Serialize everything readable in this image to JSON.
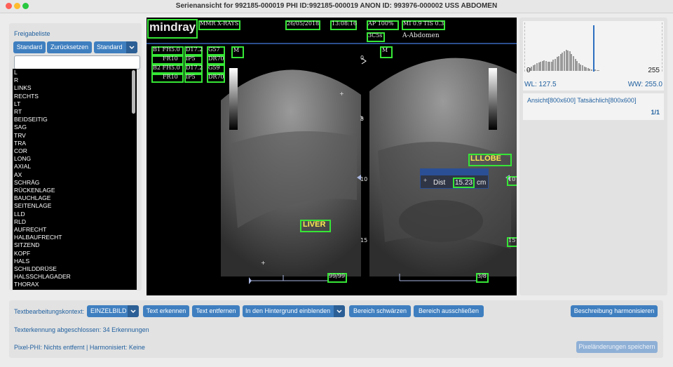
{
  "window": {
    "title": "Serienansicht for 992185-000019 PHI ID:992185-000019 ANON ID: 993976-000002 USS ABDOMEN"
  },
  "left_panel": {
    "title": "Freigabeliste",
    "buttons": {
      "standard": "Standard",
      "reset": "Zurücksetzen",
      "dropdown_value": "Standard"
    },
    "search_placeholder": "",
    "items": [
      "L",
      "R",
      "LINKS",
      "RECHTS",
      "LT",
      "RT",
      "BEIDSEITIG",
      "SAG",
      "TRV",
      "TRA",
      "COR",
      "LONG",
      "AXIAL",
      "AX",
      "SCHRÄG",
      "RÜCKENLAGE",
      "BAUCHLAGE",
      "SEITENLAGE",
      "LLD",
      "RLD",
      "AUFRECHT",
      "HALBAUFRECHT",
      "SITZEND",
      "KOPF",
      "HALS",
      "SCHILDDRÜSE",
      "HALSSCHLAGADER",
      "THORAX"
    ]
  },
  "viewer": {
    "logo": "mindray",
    "header": {
      "institution": "MMR X-RAYS",
      "date": "26/05/2018",
      "time": "13:08:16",
      "ap": "AP 100%",
      "mi": "MI 0.9",
      "tis": "TIS 0.3",
      "probe": "3C5s",
      "preset": "A-Abdomen"
    },
    "params_left": [
      [
        "B1 FH5.0",
        "D17.2",
        "G57"
      ],
      [
        "FR10",
        "IP5",
        "DR70"
      ],
      [
        "B2 FH5.0",
        "D17.2",
        "G59"
      ],
      [
        "FR10",
        "IP5",
        "DR70"
      ]
    ],
    "markers": {
      "m1": "M",
      "m2": "M"
    },
    "depth_scale": [
      "0",
      "5",
      "10",
      "15"
    ],
    "labels": {
      "liver": "LIVER",
      "lllobe": "LLLOBE"
    },
    "measurement": {
      "label": "Dist",
      "value": "15.23",
      "unit": "cm"
    },
    "right_edge": {
      "r10": "10",
      "r15": "15"
    },
    "bottom": {
      "left_value": "99/99",
      "right_value": "3/8"
    }
  },
  "right_panel": {
    "hist_min": "0",
    "hist_max": "255",
    "wl": "WL: 127.5",
    "ww": "WW: 255.0",
    "view_info": "Ansicht[800x600] Tatsächlich[800x600]",
    "page": "1/1",
    "histogram": [
      3,
      5,
      8,
      10,
      12,
      14,
      15,
      17,
      18,
      19,
      18,
      17,
      16,
      17,
      20,
      22,
      25,
      27,
      30,
      33,
      36,
      38,
      37,
      35,
      30,
      26,
      22,
      18,
      14,
      12,
      10,
      8,
      6,
      5,
      4,
      3,
      2,
      2,
      1,
      1
    ],
    "level_marker": 127.5
  },
  "bottom_panel": {
    "context_label": "Textbearbeitungskontext:",
    "context_value": "EINZELBILD",
    "buttons": {
      "recognize": "Text erkennen",
      "remove": "Text entfernen",
      "blend": "In den Hintergrund einblenden",
      "blacken": "Bereich schwärzen",
      "exclude": "Bereich ausschließen",
      "harmonize": "Beschreibung harmonisieren",
      "save": "Pixeländerungen speichern"
    },
    "status": "Texterkennung abgeschlossen: 34 Erkennungen",
    "phi_status": "Pixel-PHI: Nichts entfernt | Harmonisiert: Keine"
  }
}
